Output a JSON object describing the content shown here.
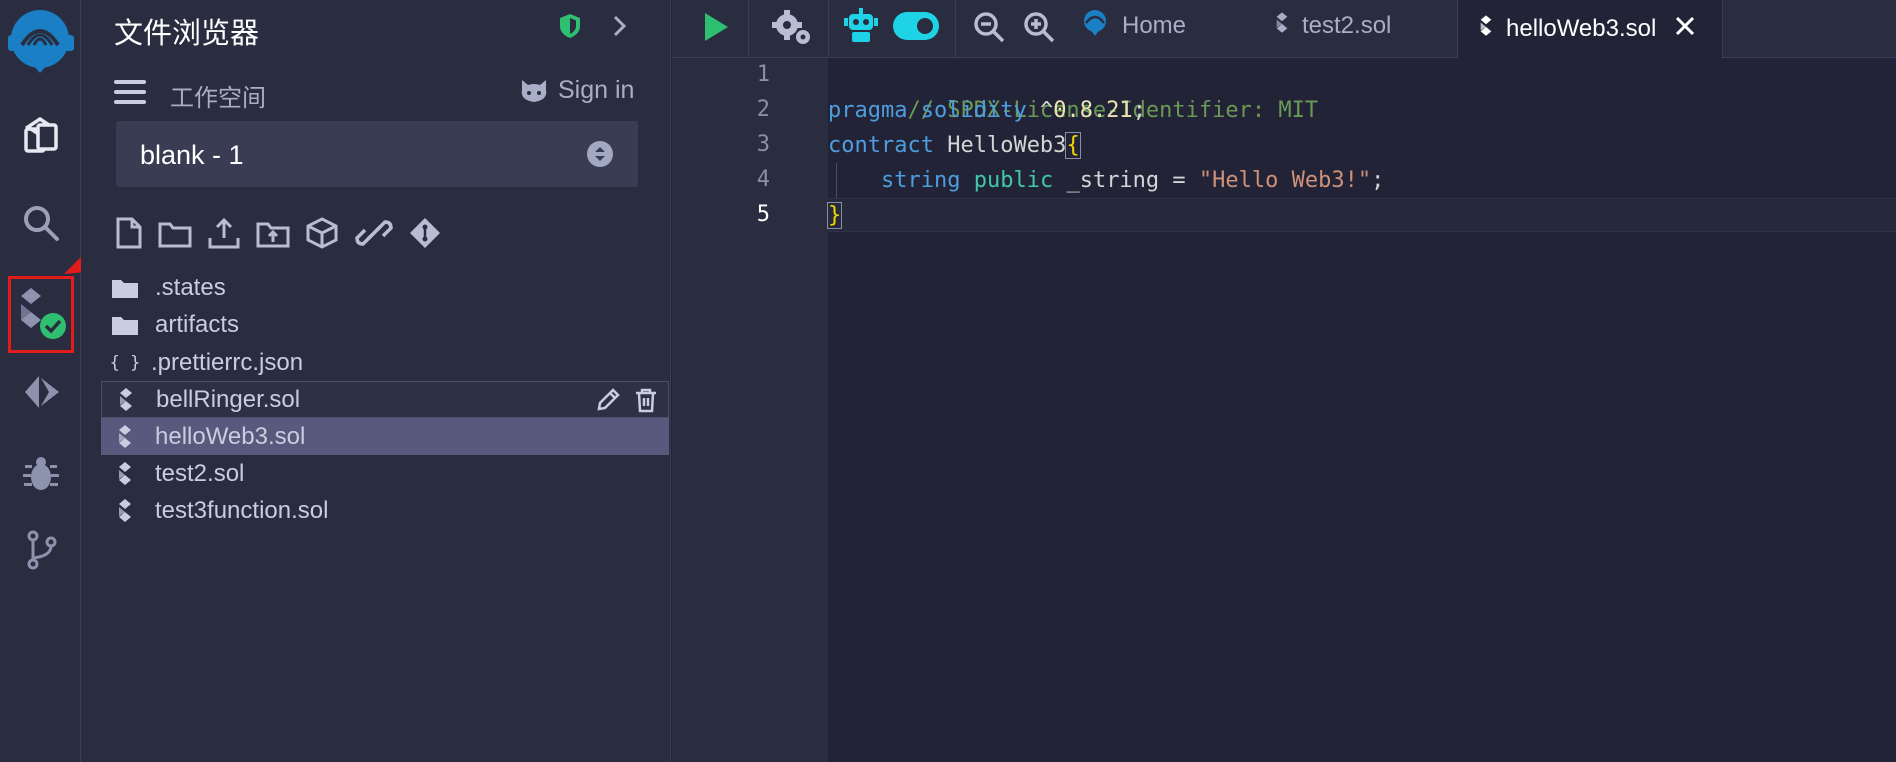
{
  "file_panel": {
    "title": "文件浏览器",
    "workspace_label": "工作空间",
    "sign_in": "Sign in",
    "workspace_select": "blank - 1",
    "files": [
      {
        "name": ".states",
        "icon": "folder-icon"
      },
      {
        "name": "artifacts",
        "icon": "folder-icon"
      },
      {
        "name": ".prettierrc.json",
        "icon": "json-braces-icon"
      },
      {
        "name": "bellRinger.sol",
        "icon": "solidity-file-icon"
      },
      {
        "name": "helloWeb3.sol",
        "icon": "solidity-file-icon"
      },
      {
        "name": "test2.sol",
        "icon": "solidity-file-icon"
      },
      {
        "name": "test3function.sol",
        "icon": "solidity-file-icon"
      }
    ]
  },
  "tabs": [
    {
      "label": "Home"
    },
    {
      "label": "test2.sol"
    },
    {
      "label": "helloWeb3.sol"
    }
  ],
  "editor": {
    "line_numbers": [
      "1",
      "2",
      "3",
      "4",
      "5"
    ],
    "line1": "// SPDX-License-Identifier: MIT",
    "line2_kw1": "pragma",
    "line2_kw2": "solidity",
    "line2_caret": "^",
    "line2_ver": "0.8.21",
    "line2_semi": ";",
    "line3_kw": "contract",
    "line3_name": "HelloWeb3",
    "line3_brace": "{",
    "line4_type": "string",
    "line4_pub": "public",
    "line4_var": "_string =",
    "line4_str": "\"Hello Web3!\"",
    "line4_semi": ";",
    "line5_brace": "}"
  },
  "colors": {
    "accent_green": "#2fbf71",
    "toggle_cyan": "#1fd3e6",
    "annotation_red": "#e21b1b"
  }
}
